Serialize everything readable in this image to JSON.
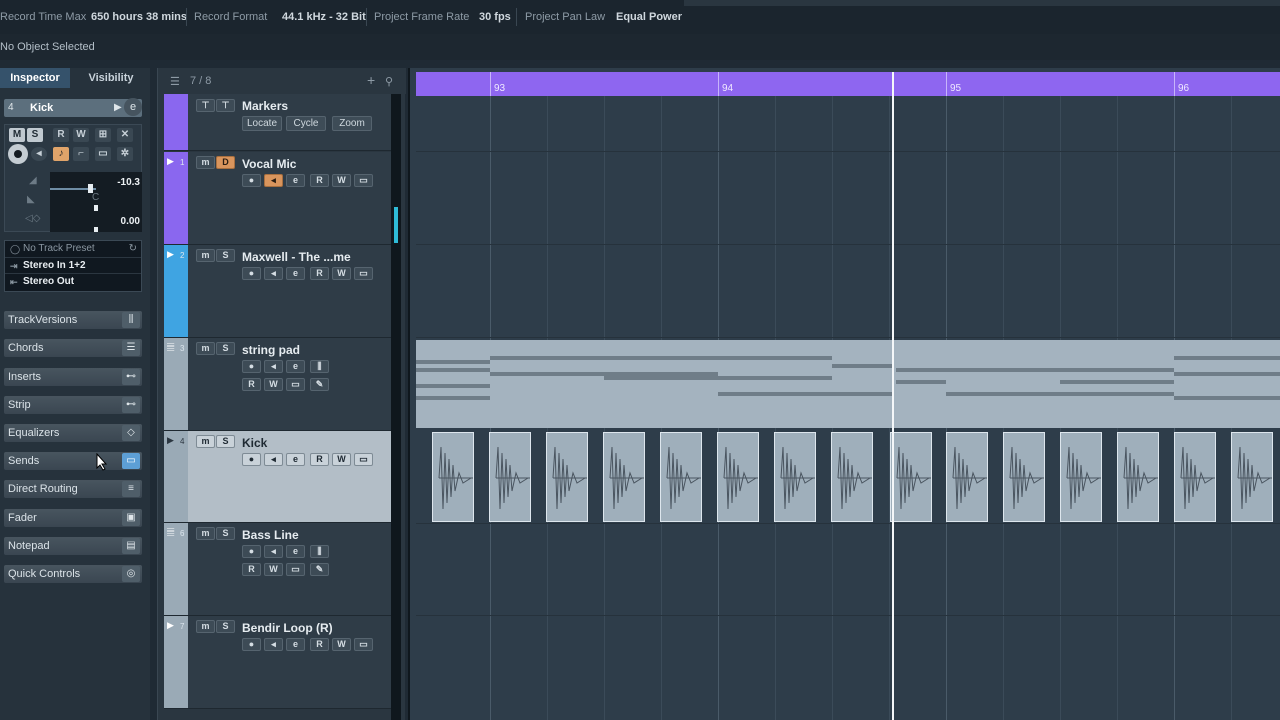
{
  "status": {
    "items": [
      {
        "label": "Record Time Max",
        "value": "650 hours 38 mins"
      },
      {
        "label": "Record Format",
        "value": "44.1 kHz - 32 Bit"
      },
      {
        "label": "Project Frame Rate",
        "value": "30 fps"
      },
      {
        "label": "Project Pan Law",
        "value": "Equal Power"
      }
    ]
  },
  "infoline": {
    "text": "No Object Selected"
  },
  "inspector": {
    "tabs": [
      "Inspector",
      "Visibility"
    ],
    "track_number": "4",
    "track_name": "Kick",
    "volume": "-10.3",
    "pan_center": "C",
    "pan_value": "0.00",
    "preset": "No Track Preset",
    "input": "Stereo In 1+2",
    "output": "Stereo Out",
    "sections": [
      {
        "label": "TrackVersions",
        "icon": "track-versions-icon"
      },
      {
        "label": "Chords",
        "icon": "chords-icon"
      },
      {
        "label": "Inserts",
        "icon": "inserts-icon"
      },
      {
        "label": "Strip",
        "icon": "strip-icon"
      },
      {
        "label": "Equalizers",
        "icon": "equalizer-icon"
      },
      {
        "label": "Sends",
        "icon": "sends-icon"
      },
      {
        "label": "Direct Routing",
        "icon": "routing-icon"
      },
      {
        "label": "Fader",
        "icon": "fader-icon"
      },
      {
        "label": "Notepad",
        "icon": "notepad-icon"
      },
      {
        "label": "Quick Controls",
        "icon": "quick-controls-icon"
      }
    ]
  },
  "tracklist": {
    "count": "7 / 8",
    "markers": {
      "name": "Markers",
      "buttons": [
        "Locate",
        "Cycle",
        "Zoom"
      ]
    },
    "tracks": [
      {
        "num": "1",
        "name": "Vocal Mic",
        "color": "#8a67ef"
      },
      {
        "num": "2",
        "name": "Maxwell - The ...me",
        "color": "#3fa4e2"
      },
      {
        "num": "3",
        "name": "string pad",
        "color": "#9aaab6"
      },
      {
        "num": "4",
        "name": "Kick",
        "color": "#9aaab6"
      },
      {
        "num": "6",
        "name": "Bass Line",
        "color": "#9aaab6"
      },
      {
        "num": "7",
        "name": "Bendir Loop (R)",
        "color": "#9aaab6"
      }
    ]
  },
  "ruler": {
    "bars": [
      "93",
      "94",
      "95",
      "96"
    ]
  },
  "colors": {
    "ruler": "#8e66f0",
    "accent": "#5d9fd6",
    "record_orange": "#d9955d"
  }
}
